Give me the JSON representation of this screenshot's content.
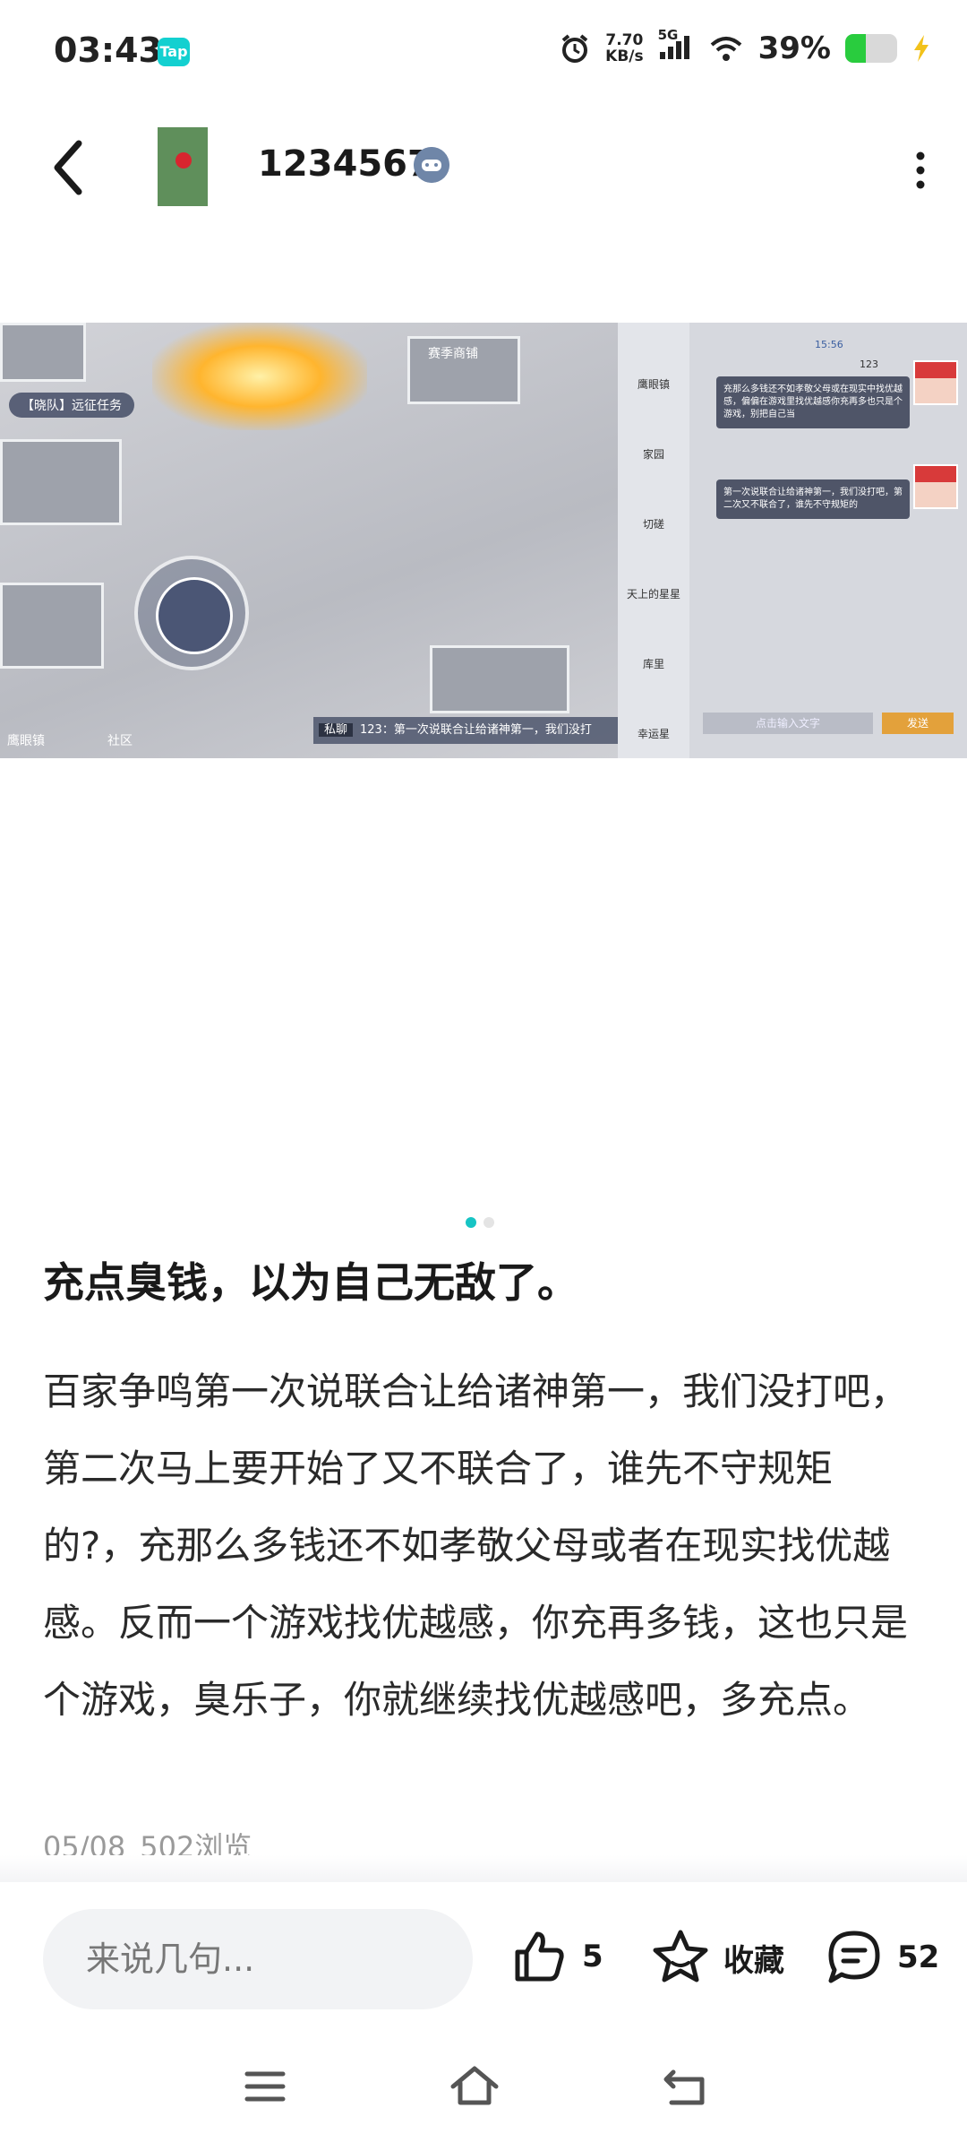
{
  "status_bar": {
    "time": "03:43",
    "app_badge": "Tap",
    "net_speed_value": "7.70",
    "net_speed_unit": "KB/s",
    "network": "5G",
    "battery_percent": "39%",
    "battery_level": 0.39
  },
  "header": {
    "username": "1234567"
  },
  "screenshot": {
    "chat_message_1": "充那么多钱还不如孝敬父母或在现实中找优越感，偏偏在游戏里找优越感你充再多也只是个游戏，别把自己当",
    "chat_message_2": "第一次说联合让给诸神第一，我们没打吧，第二次又不联合了，谁先不守规矩的",
    "chat_time": "15:56",
    "chat_player": "123",
    "team_task": "【晓队】远征任务",
    "shop_label": "赛季商铺",
    "side_items": [
      "鹰眼镇",
      "家园",
      "切磋",
      "天上的星星",
      "库里",
      "幸运星"
    ],
    "bottom_labels": [
      "鹰眼镇",
      "社区"
    ],
    "chat_bar": "123：第一次说联合让给诸神第一，我们没打",
    "chat_tag": "私聊",
    "input_placeholder": "点击输入文字",
    "send_label": "发送"
  },
  "pager": {
    "total": 2,
    "active_index": 0
  },
  "post": {
    "title": "充点臭钱，以为自己无敌了。",
    "body": "百家争鸣第一次说联合让给诸神第一，我们没打吧，第二次马上要开始了又不联合了，谁先不守规矩的?，充那么多钱还不如孝敬父母或者在现实找优越感。反而一个游戏找优越感，你充再多钱，这也只是个游戏，臭乐子，你就继续找优越感吧，多充点。",
    "date": "05/08",
    "views": "502浏览"
  },
  "action_bar": {
    "comment_placeholder": "来说几句...",
    "like_count": "5",
    "favorite_label": "收藏",
    "comment_count": "52"
  },
  "colors": {
    "accent": "#17c4c4",
    "battery": "#29cc3e"
  }
}
